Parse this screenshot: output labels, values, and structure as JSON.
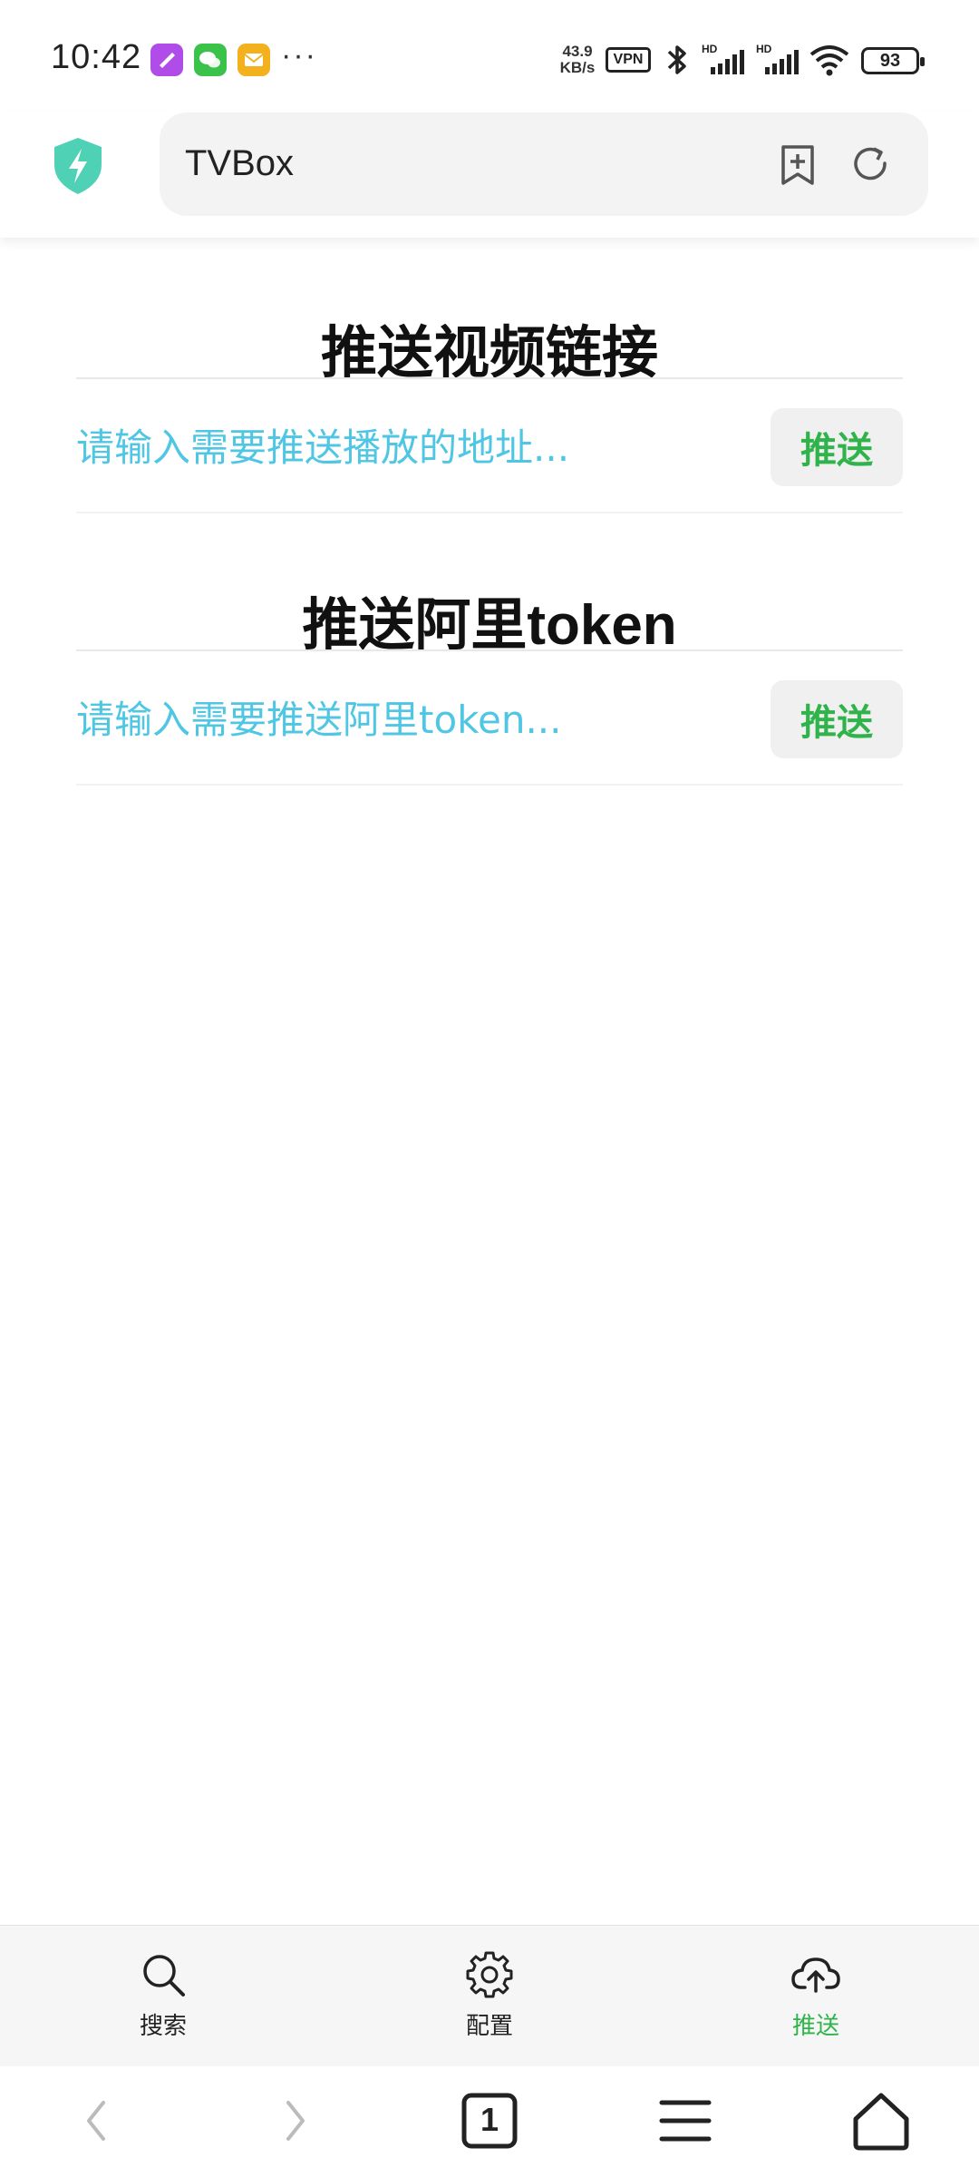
{
  "status_bar": {
    "time": "10:42",
    "more": "···",
    "net_speed_value": "43.9",
    "net_speed_unit": "KB/s",
    "vpn": "VPN",
    "battery": "93",
    "icons": [
      "app-purple-icon",
      "wechat-icon",
      "mail-icon",
      "bluetooth-icon",
      "signal-hd-icon",
      "signal-hd-icon",
      "wifi-icon",
      "battery-icon"
    ]
  },
  "browser": {
    "url_text": "TVBox",
    "icons": [
      "shield-lightning-icon",
      "bookmark-add-icon",
      "refresh-icon"
    ]
  },
  "sections": [
    {
      "title": "推送视频链接",
      "placeholder": "请输入需要推送播放的地址...",
      "button": "推送"
    },
    {
      "title": "推送阿里token",
      "placeholder": "请输入需要推送阿里token...",
      "button": "推送"
    }
  ],
  "tabs": [
    {
      "label": "搜索",
      "icon": "search-icon",
      "active": false
    },
    {
      "label": "配置",
      "icon": "gear-icon",
      "active": false
    },
    {
      "label": "推送",
      "icon": "cloud-upload-icon",
      "active": true
    }
  ],
  "nav": {
    "tab_count": "1",
    "icons": [
      "back-icon",
      "forward-icon",
      "tabs-icon",
      "menu-icon",
      "home-icon"
    ]
  },
  "colors": {
    "accent_green": "#2fb34a",
    "input_text": "#4fc6e3",
    "shield": "#4fd1b5"
  }
}
